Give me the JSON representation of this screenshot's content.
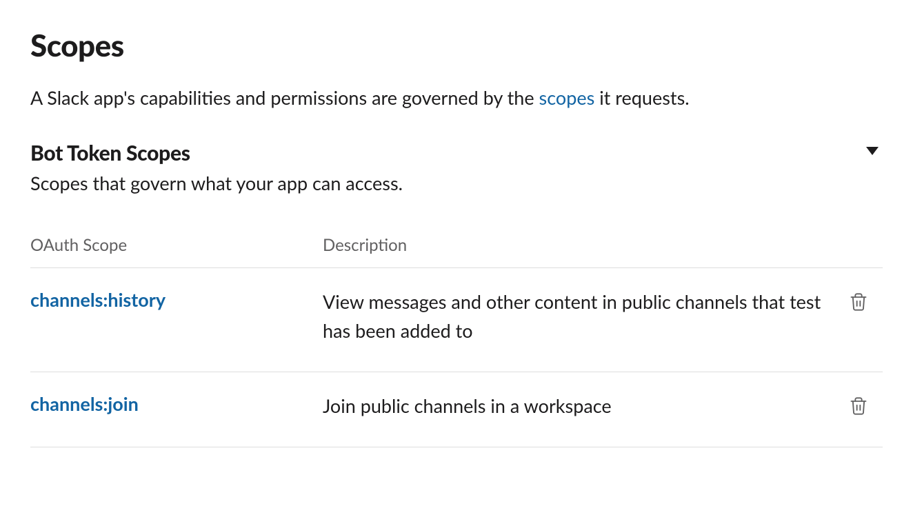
{
  "page": {
    "title": "Scopes",
    "intro_prefix": "A Slack app's capabilities and permissions are governed by the ",
    "intro_link": "scopes",
    "intro_suffix": " it requests."
  },
  "section": {
    "title": "Bot Token Scopes",
    "subtitle": "Scopes that govern what your app can access."
  },
  "table": {
    "header_scope": "OAuth Scope",
    "header_description": "Description",
    "rows": [
      {
        "scope": "channels:history",
        "description": "View messages and other content in public channels that test has been added to"
      },
      {
        "scope": "channels:join",
        "description": "Join public channels in a workspace"
      }
    ]
  }
}
